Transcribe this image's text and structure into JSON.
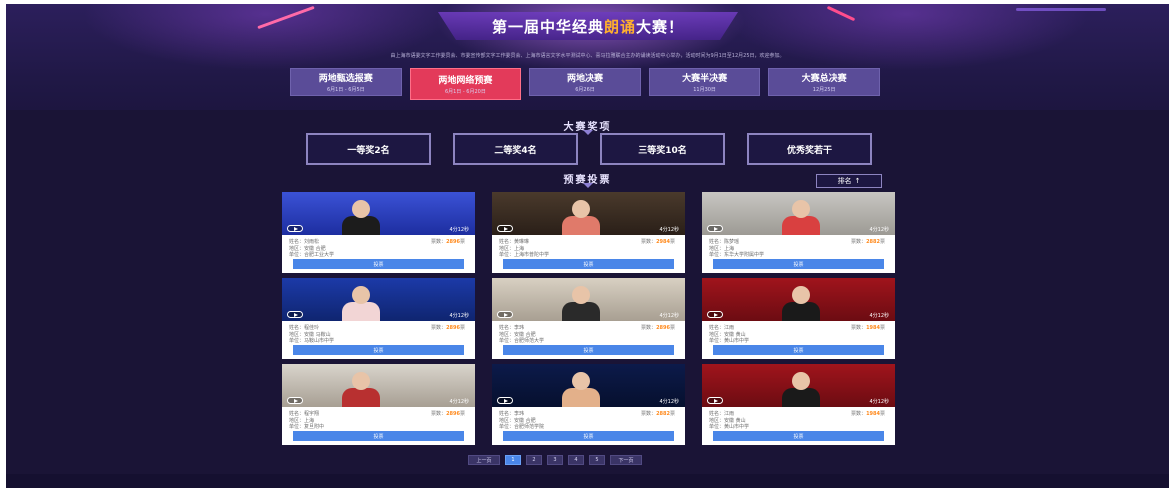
{
  "header": {
    "title_pre": "第一届中华经典",
    "title_hl": "朗诵",
    "title_post": "大赛！",
    "intro": "由上海市语委文字工作委员会、市委宣传部文字工作委员会、上海市语言文字水平测试中心、喜马拉雅联合主办的诵读活动中心举办，活动时间为9月1日至12月25日，欢迎参加。",
    "accent_color": "#ffb02e"
  },
  "stages": [
    {
      "name": "两地甄选报赛",
      "date": "6月1日 - 6月5日",
      "active": false
    },
    {
      "name": "两地网络预赛",
      "date": "6月1日 - 6月20日",
      "active": true
    },
    {
      "name": "两地决赛",
      "date": "6月26日",
      "active": false
    },
    {
      "name": "大赛半决赛",
      "date": "11月30日",
      "active": false
    },
    {
      "name": "大赛总决赛",
      "date": "12月25日",
      "active": false
    }
  ],
  "prizes_section": {
    "title": "大赛奖项",
    "items": [
      "一等奖2名",
      "二等奖4名",
      "三等奖10名",
      "优秀奖若干"
    ]
  },
  "entries_section": {
    "title": "预赛投票",
    "rank_label": "排名",
    "rank_icon": "arrow-up-icon",
    "vote_label": "投票",
    "name_label": "姓名：",
    "area_label": "地区：",
    "school_label": "单位：",
    "votes_label": "票数：",
    "votes_unit": "票",
    "entries": [
      {
        "name": "刘雨松",
        "area": "安徽 合肥",
        "school": "合肥工业大学",
        "votes": "2896",
        "duration": "4分12秒"
      },
      {
        "name": "黄琳琳",
        "area": "上海",
        "school": "上海市普陀中学",
        "votes": "2984",
        "duration": "4分12秒"
      },
      {
        "name": "陈梦瑶",
        "area": "上海",
        "school": "东华大学附属中学",
        "votes": "2882",
        "duration": "4分12秒"
      },
      {
        "name": "程佳玲",
        "area": "安徽 马鞍山",
        "school": "马鞍山市中学",
        "votes": "2896",
        "duration": "4分12秒"
      },
      {
        "name": "李玮",
        "area": "安徽 合肥",
        "school": "合肥师范大学",
        "votes": "2896",
        "duration": "4分12秒"
      },
      {
        "name": "江雨",
        "area": "安徽 黄山",
        "school": "黄山市中学",
        "votes": "1984",
        "duration": "4分12秒"
      },
      {
        "name": "程宇翔",
        "area": "上海",
        "school": "复旦附中",
        "votes": "2896",
        "duration": "4分12秒"
      },
      {
        "name": "李玮",
        "area": "安徽 合肥",
        "school": "合肥师范学院",
        "votes": "2882",
        "duration": "4分12秒"
      },
      {
        "name": "江雨",
        "area": "安徽 黄山",
        "school": "黄山市中学",
        "votes": "1984",
        "duration": "4分12秒"
      }
    ]
  },
  "pagination": {
    "prev": "上一页",
    "pages": [
      "1",
      "2",
      "3",
      "4",
      "5"
    ],
    "current": "1",
    "next": "下一页"
  }
}
